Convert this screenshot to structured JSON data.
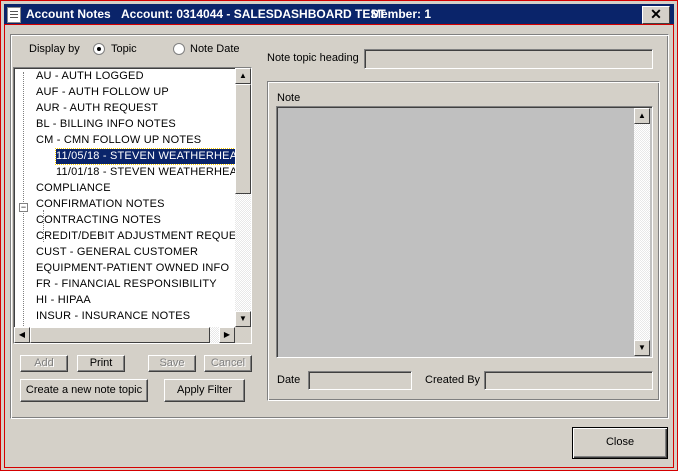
{
  "window": {
    "title": "Account Notes",
    "account": "Account: 0314044 - SALESDASHBOARD TEST",
    "member": "Member: 1",
    "close_glyph": "✕"
  },
  "display_by": {
    "label": "Display by",
    "options": [
      "Topic",
      "Note Date"
    ],
    "selected": "Topic"
  },
  "tree": {
    "items": [
      {
        "label": "AU - AUTH LOGGED",
        "level": 0
      },
      {
        "label": "AUF - AUTH FOLLOW UP",
        "level": 0
      },
      {
        "label": "AUR - AUTH REQUEST",
        "level": 0
      },
      {
        "label": "BL - BILLING INFO NOTES",
        "level": 0
      },
      {
        "label": "CM - CMN FOLLOW UP NOTES",
        "level": 0,
        "expanded": true
      },
      {
        "label": "11/05/18 - STEVEN WEATHERHEA",
        "level": 1,
        "selected": true
      },
      {
        "label": "11/01/18 - STEVEN WEATHERHEA",
        "level": 1
      },
      {
        "label": "COMPLIANCE",
        "level": 0
      },
      {
        "label": "CONFIRMATION NOTES",
        "level": 0
      },
      {
        "label": "CONTRACTING NOTES",
        "level": 0
      },
      {
        "label": "CREDIT/DEBIT ADJUSTMENT REQUES",
        "level": 0
      },
      {
        "label": "CUST - GENERAL CUSTOMER",
        "level": 0
      },
      {
        "label": "EQUIPMENT-PATIENT OWNED INFO",
        "level": 0
      },
      {
        "label": "FR - FINANCIAL RESPONSIBILITY",
        "level": 0
      },
      {
        "label": "HI - HIPAA",
        "level": 0
      },
      {
        "label": "INSUR - INSURANCE NOTES",
        "level": 0
      }
    ]
  },
  "buttons": {
    "add": "Add",
    "print": "Print",
    "save": "Save",
    "cancel": "Cancel",
    "create_topic": "Create a new note topic",
    "apply_filter": "Apply Filter",
    "close": "Close"
  },
  "note_panel": {
    "topic_heading_label": "Note topic heading",
    "topic_heading_value": "",
    "note_label": "Note",
    "note_value": "",
    "date_label": "Date",
    "date_value": "",
    "created_by_label": "Created By",
    "created_by_value": ""
  },
  "colors": {
    "title_bar": "#0a246a",
    "face": "#d4d0c8",
    "selection": "#0a246a",
    "note_bg": "#c0c0c0",
    "accent_border": "#d40000"
  }
}
